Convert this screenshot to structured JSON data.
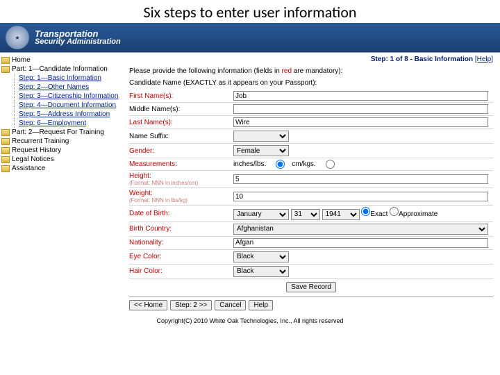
{
  "slide_title": "Six steps to enter user information",
  "banner": {
    "line1": "Transportation",
    "line2": "Security",
    "line3": "Administration"
  },
  "sidebar": {
    "home": "Home",
    "part1": "Part: 1—Candidate Information",
    "steps": [
      "Step: 1—Basic Information",
      "Step: 2—Other Names",
      "Step: 3—Citizenship Information",
      "Step: 4—Document Information",
      "Step: 5—Address Information",
      "Step: 6—Employment"
    ],
    "other": [
      "Part: 2—Request For Training",
      "Recurrent Training",
      "Request History",
      "Legal Notices",
      "Assistance"
    ]
  },
  "header": {
    "step_text": "Step: 1 of 8 - Basic Information",
    "help": "[Help]"
  },
  "intro": {
    "pre": "Please provide the following information (fields in ",
    "red": "red",
    "post": " are mandatory):"
  },
  "section_label": "Candidate Name (EXACTLY as it appears on your Passport):",
  "fields": {
    "first_name": {
      "label": "First Name(s):",
      "value": "Job"
    },
    "middle_name": {
      "label": "Middle Name(s):",
      "value": ""
    },
    "last_name": {
      "label": "Last Name(s):",
      "value": "Wire"
    },
    "suffix": {
      "label": "Name Suffix:",
      "value": ""
    },
    "gender": {
      "label": "Gender:",
      "value": "Female"
    },
    "measurements": {
      "label": "Measurements:",
      "opt1": "inches/lbs.",
      "opt2": "cm/kgs."
    },
    "height": {
      "label": "Height:",
      "hint": "(Format: NNN in inches/cm)",
      "value": "5"
    },
    "weight": {
      "label": "Weight:",
      "hint": "(Format: NNN in lbs/kg)",
      "value": "10"
    },
    "dob": {
      "label": "Date of Birth:",
      "month": "January",
      "day": "31",
      "year": "1941",
      "exact": "Exact",
      "approx": "Approximate"
    },
    "birth_country": {
      "label": "Birth Country:",
      "value": "Afghanistan"
    },
    "nationality": {
      "label": "Nationality:",
      "value": "Afgan"
    },
    "eye": {
      "label": "Eye Color:",
      "value": "Black"
    },
    "hair": {
      "label": "Hair Color:",
      "value": "Black"
    }
  },
  "buttons": {
    "save": "Save Record",
    "home": "<< Home",
    "next": "Step: 2 >>",
    "cancel": "Cancel",
    "help": "Help"
  },
  "copyright": "Copyright(C) 2010 White Oak Technologies, Inc., All rights reserved"
}
